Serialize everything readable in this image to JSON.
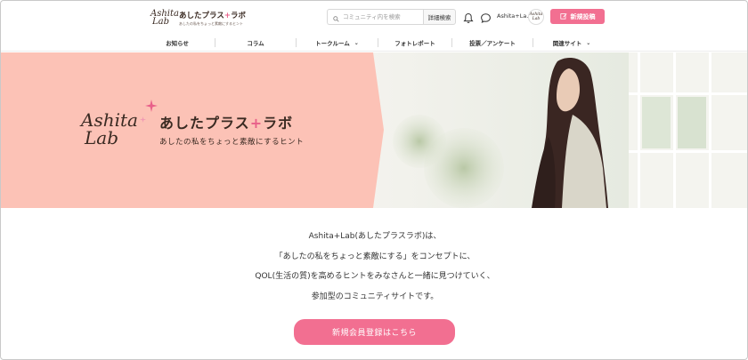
{
  "header": {
    "logo": {
      "mark_line1": "Ashita",
      "mark_line2": "Lab",
      "name_part1": "あしたプラス",
      "name_plus": "+",
      "name_part2": "ラボ",
      "tagline": "あしたの私をちょっと素敵にするヒント"
    },
    "search": {
      "placeholder": "コミュニティ内を検索",
      "value": ""
    },
    "detail_search_label": "詳細検索",
    "username": "Ashita+La...",
    "avatar": {
      "line1": "Ashita",
      "line2": "Lab"
    },
    "new_post_label": "新規投稿"
  },
  "nav": {
    "items": [
      {
        "label": "お知らせ",
        "has_dropdown": false
      },
      {
        "label": "コラム",
        "has_dropdown": false
      },
      {
        "label": "トークルーム",
        "has_dropdown": true
      },
      {
        "label": "フォトレポート",
        "has_dropdown": false
      },
      {
        "label": "投票／アンケート",
        "has_dropdown": false
      },
      {
        "label": "関連サイト",
        "has_dropdown": true
      }
    ]
  },
  "hero": {
    "logo": {
      "mark_line1": "Ashita",
      "mark_line2": "Lab",
      "name_part1": "あしたプラス",
      "name_plus": "+",
      "name_part2": "ラボ",
      "tagline": "あしたの私をちょっと素敵にするヒント"
    }
  },
  "intro": {
    "lines": [
      "Ashita+Lab(あしたプラスラボ)は、",
      "「あしたの私をちょっと素敵にする」をコンセプトに、",
      "QOL(生活の質)を高めるヒントをみなさんと一緒に見つけていく、",
      "参加型のコミュニティサイトです。"
    ]
  },
  "cta_label": "新規会員登録はこちら",
  "colors": {
    "accent": "#f26f91",
    "hero_pink": "#fcc2b6",
    "logo_brown": "#3a2a22",
    "sparkle": "#e8608a"
  },
  "icons": [
    "search-icon",
    "bell-icon",
    "chat-icon",
    "pencil-icon",
    "chevron-down-icon",
    "sparkle-icon"
  ]
}
